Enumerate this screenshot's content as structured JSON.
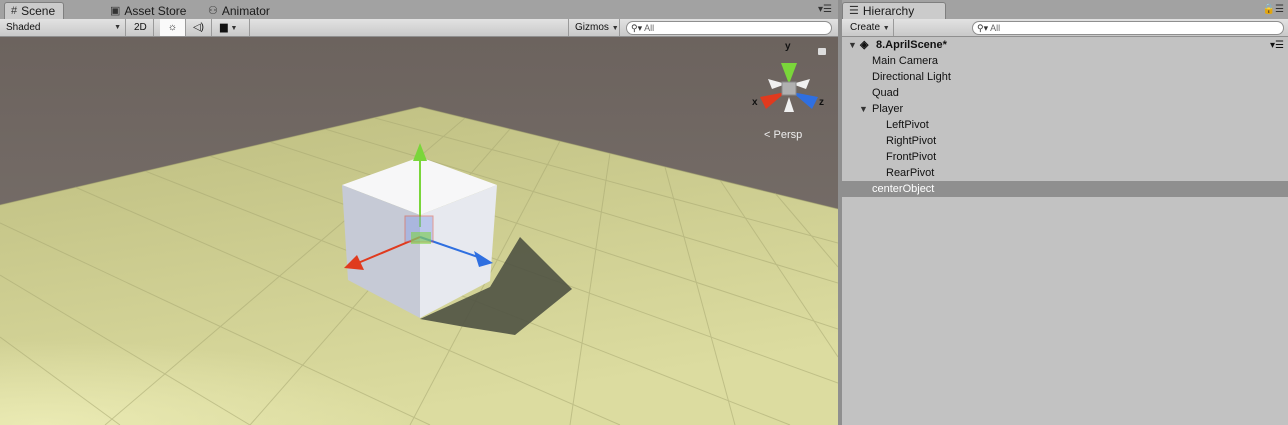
{
  "scene_panel": {
    "tabs": [
      {
        "label": "Scene",
        "icon": "grid-icon",
        "active": true
      },
      {
        "label": "Asset Store",
        "icon": "store-icon",
        "active": false
      },
      {
        "label": "Animator",
        "icon": "animator-icon",
        "active": false
      }
    ],
    "toolbar": {
      "draw_mode": "Shaded",
      "mode_2d": "2D",
      "gizmos": "Gizmos",
      "search_placeholder": "All"
    },
    "orientation_gizmo": {
      "x": "x",
      "y": "y",
      "z": "z"
    },
    "projection": "Persp"
  },
  "hierarchy_panel": {
    "tab": {
      "label": "Hierarchy",
      "icon": "list-icon"
    },
    "create": "Create",
    "search_placeholder": "All",
    "scene_name": "8.AprilScene*",
    "items": [
      {
        "label": "Main Camera",
        "depth": 1
      },
      {
        "label": "Directional Light",
        "depth": 1
      },
      {
        "label": "Quad",
        "depth": 1
      },
      {
        "label": "Player",
        "depth": 1,
        "expanded": true
      },
      {
        "label": "LeftPivot",
        "depth": 2
      },
      {
        "label": "RightPivot",
        "depth": 2
      },
      {
        "label": "FrontPivot",
        "depth": 2
      },
      {
        "label": "RearPivot",
        "depth": 2
      },
      {
        "label": "centerObject",
        "depth": 1,
        "selected": true
      }
    ]
  },
  "colors": {
    "sky": "#6f6661",
    "ground": "#c9c98c",
    "selection": "#8f8f8f",
    "axis_x": "#e03a1e",
    "axis_y": "#7ad63a",
    "axis_z": "#2f6fe0"
  }
}
